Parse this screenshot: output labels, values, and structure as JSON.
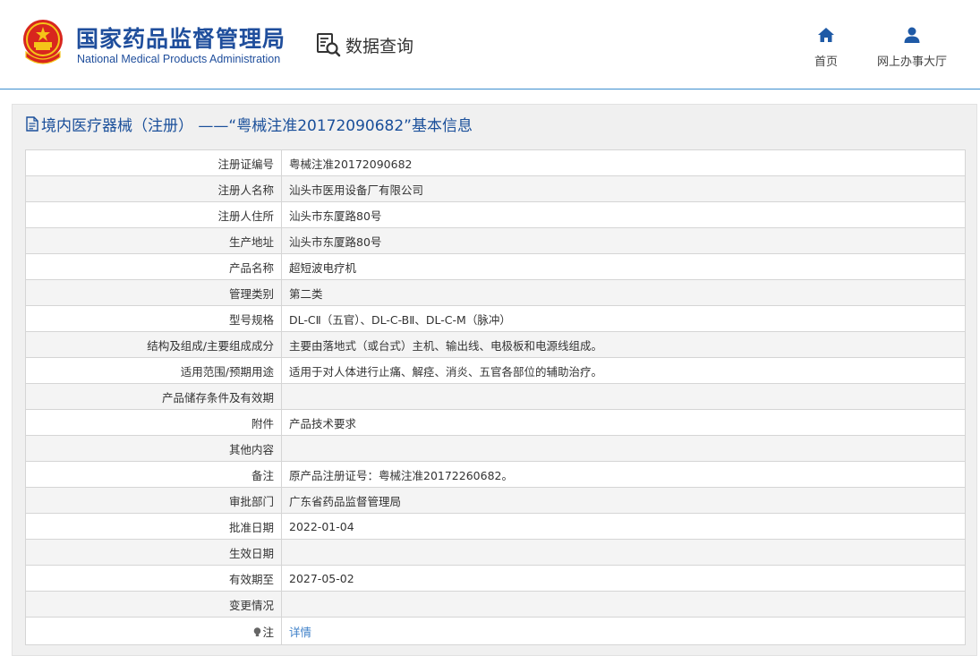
{
  "header": {
    "org_name_cn": "国家药品监督管理局",
    "org_name_en": "National Medical Products Administration",
    "query_label": "数据查询",
    "nav": [
      {
        "label": "首页",
        "icon": "home-icon"
      },
      {
        "label": "网上办事大厅",
        "icon": "user-icon"
      }
    ]
  },
  "panel": {
    "title": "境内医疗器械（注册） ——“粤械注准20172090682”基本信息",
    "title_icon": "document-icon"
  },
  "rows": [
    {
      "label": "注册证编号",
      "value": "粤械注准20172090682"
    },
    {
      "label": "注册人名称",
      "value": "汕头市医用设备厂有限公司"
    },
    {
      "label": "注册人住所",
      "value": "汕头市东厦路80号"
    },
    {
      "label": "生产地址",
      "value": "汕头市东厦路80号"
    },
    {
      "label": "产品名称",
      "value": "超短波电疗机"
    },
    {
      "label": "管理类别",
      "value": "第二类"
    },
    {
      "label": "型号规格",
      "value": "DL-CⅡ（五官）、DL-C-BⅡ、DL-C-M（脉冲）"
    },
    {
      "label": "结构及组成/主要组成成分",
      "value": "主要由落地式（或台式）主机、输出线、电极板和电源线组成。"
    },
    {
      "label": "适用范围/预期用途",
      "value": "适用于对人体进行止痛、解痉、消炎、五官各部位的辅助治疗。"
    },
    {
      "label": "产品储存条件及有效期",
      "value": ""
    },
    {
      "label": "附件",
      "value": "产品技术要求"
    },
    {
      "label": "其他内容",
      "value": ""
    },
    {
      "label": "备注",
      "value": "原产品注册证号：粤械注准20172260682。"
    },
    {
      "label": "审批部门",
      "value": "广东省药品监督管理局"
    },
    {
      "label": "批准日期",
      "value": "2022-01-04"
    },
    {
      "label": "生效日期",
      "value": ""
    },
    {
      "label": "有效期至",
      "value": "2027-05-02"
    },
    {
      "label": "变更情况",
      "value": ""
    }
  ],
  "note": {
    "label": "注",
    "link": "详情",
    "icon": "bulb-icon"
  },
  "colors": {
    "brand": "#1f4e9c",
    "link": "#3c7fc8",
    "border": "#d5d5d5",
    "divider": "#3c8fcf"
  }
}
